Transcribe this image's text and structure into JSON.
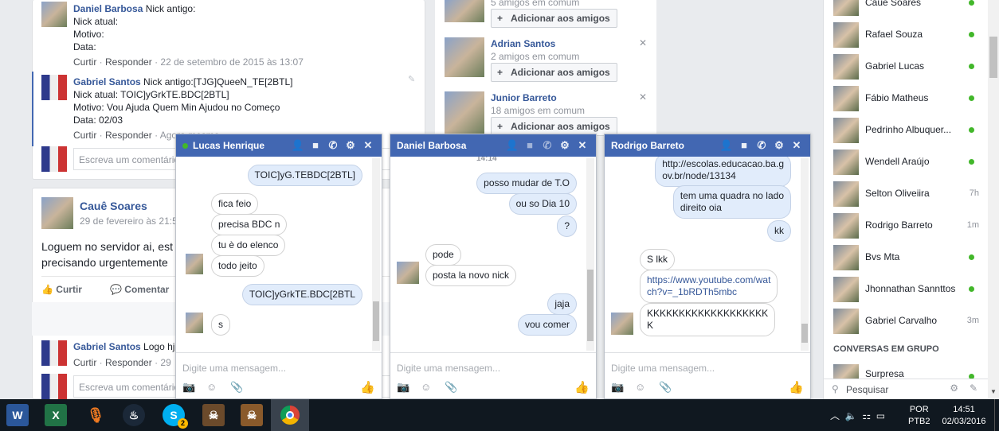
{
  "feed": {
    "comment1": {
      "author": "Daniel Barbosa",
      "text": "Nick antigo:",
      "line2": "Nick atual:",
      "line3": "Motivo:",
      "line4": "Data:",
      "like": "Curtir",
      "reply": "Responder",
      "time": "22 de setembro de 2015 às 13:07"
    },
    "comment2": {
      "author": "Gabriel Santos",
      "text": "Nick antigo:[TJG]QueeN_TE[2BTL]",
      "line2": "Nick atual: TOIC]yGrkTE.BDC[2BTL]",
      "line3": "Motivo: Vou Ajuda Quem Min Ajudou no Começo",
      "line4": "Data: 02/03",
      "like": "Curtir",
      "reply": "Responder",
      "time": "Agora mesmo"
    },
    "comment_placeholder": "Escreva um comentário...",
    "post": {
      "author": "Cauê Soares",
      "date": "29 de fevereiro às 21:5",
      "text1": "Loguem no servidor ai, est",
      "text2": "precisando urgentemente",
      "like": "Curtir",
      "comment": "Comentar"
    },
    "comment3": {
      "author": "Gabriel Santos",
      "text": "Logo hj",
      "like": "Curtir",
      "reply": "Responder",
      "time": "29"
    },
    "comment_placeholder2": "Escreva um comentário..."
  },
  "suggestions": [
    {
      "name": "",
      "mutual": "5 amigos em comum",
      "button": "Adicionar aos amigos"
    },
    {
      "name": "Adrian Santos",
      "mutual": "2 amigos em comum",
      "button": "Adicionar aos amigos"
    },
    {
      "name": "Junior Barreto",
      "mutual": "18 amigos em comum",
      "button": "Adicionar aos amigos"
    }
  ],
  "chats": [
    {
      "name": "Lucas Henrique",
      "placeholder": "Digite uma mensagem...",
      "messages": [
        "TOIC]yG.TEBDC[2BTL]",
        "fica feio",
        "precisa BDC n",
        "tu è do elenco",
        "todo jeito",
        "TOIC]yGrkTE.BDC[2BTL",
        "s"
      ]
    },
    {
      "name": "Daniel Barbosa",
      "placeholder": "Digite uma mensagem...",
      "time": "14:14",
      "messages": [
        "posso mudar de T.O",
        "ou so Dia 10",
        "?",
        "pode",
        "posta la novo nick",
        "jaja",
        "vou comer"
      ]
    },
    {
      "name": "Rodrigo Barreto",
      "placeholder": "Digite uma mensagem...",
      "messages": [
        "http://escolas.educacao.ba.g",
        "ov.br/node/13134",
        "tem uma quadra no lado",
        "direito oia",
        "kk",
        "S lkk",
        "https://www.youtube.com/wat",
        "ch?v=_1bRDTh5mbc",
        "KKKKKKKKKKKKKKKKKKK",
        "K"
      ]
    }
  ],
  "sidebar": {
    "contacts": [
      {
        "name": "Cauê Soares",
        "status": "online"
      },
      {
        "name": "Rafael Souza",
        "status": "online"
      },
      {
        "name": "Gabriel Lucas",
        "status": "online"
      },
      {
        "name": "Fábio Matheus",
        "status": "online"
      },
      {
        "name": "Pedrinho Albuquer...",
        "status": "online"
      },
      {
        "name": "Wendell Araújo",
        "status": "online"
      },
      {
        "name": "Selton Oliveiira",
        "time": "7h"
      },
      {
        "name": "Rodrigo Barreto",
        "time": "1m"
      },
      {
        "name": "Bvs Mta",
        "status": "online"
      },
      {
        "name": "Jhonnathan Sannttos",
        "status": "online"
      },
      {
        "name": "Gabriel Carvalho",
        "time": "3m"
      }
    ],
    "group_header": "CONVERSAS EM GRUPO",
    "group": "Surpresa",
    "search": "Pesquisar"
  },
  "taskbar": {
    "lang1": "POR",
    "lang2": "PTB2",
    "time": "14:51",
    "date": "02/03/2016",
    "skype_badge": "2"
  },
  "colors": {
    "fb_blue": "#4267b2",
    "online": "#42b72a",
    "taskbar": "#101820"
  }
}
